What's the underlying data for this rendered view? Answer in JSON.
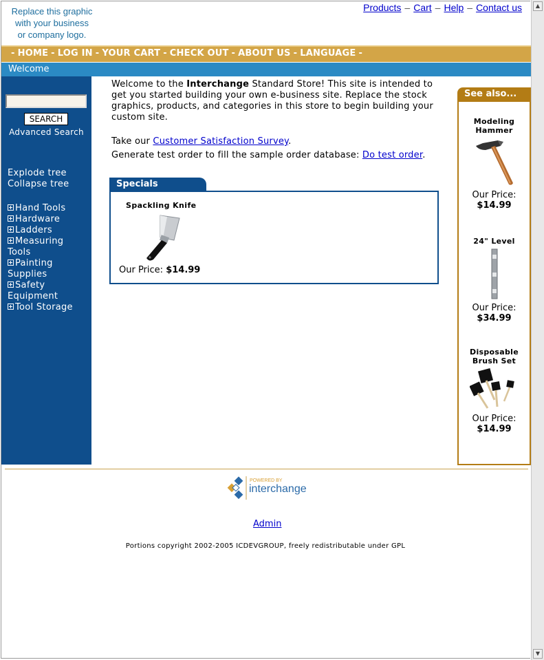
{
  "logo": {
    "line1": "Replace this graphic",
    "line2": "with your business",
    "line3": "or company logo."
  },
  "top_links": [
    "Products",
    "Cart",
    "Help",
    "Contact us"
  ],
  "navbar": [
    "HOME",
    "LOG IN",
    "YOUR CART",
    "CHECK OUT",
    "ABOUT US",
    "LANGUAGE"
  ],
  "welcome_bar": "Welcome",
  "sidebar": {
    "search_button": "SEARCH",
    "advanced_search": "Advanced Search",
    "explode_tree": "Explode tree",
    "collapse_tree": "Collapse tree",
    "categories": [
      "Hand Tools",
      "Hardware",
      "Ladders",
      "Measuring Tools",
      "Painting Supplies",
      "Safety Equipment",
      "Tool Storage"
    ]
  },
  "main": {
    "intro_pre": "Welcome to the ",
    "intro_bold": "Interchange",
    "intro_post": " Standard Store! This site is intended to get you started building your own e-business site. Replace the stock graphics, products, and categories in this store to begin building your custom site.",
    "survey_pre": "Take our ",
    "survey_link": "Customer Satisfaction Survey",
    "survey_post": ".",
    "test_pre": "Generate test order to fill the sample order database: ",
    "test_link": "Do test order",
    "test_post": "."
  },
  "specials": {
    "tab": "Specials",
    "item": {
      "name": "Spackling Knife",
      "price_label": "Our Price:",
      "price": "$14.99"
    }
  },
  "see_also": {
    "title": "See also...",
    "items": [
      {
        "name1": "Modeling",
        "name2": "Hammer",
        "price_label": "Our Price:",
        "price": "$14.99"
      },
      {
        "name1": "24\" Level",
        "name2": "",
        "price_label": "Our Price:",
        "price": "$34.99"
      },
      {
        "name1": "Disposable",
        "name2": "Brush Set",
        "price_label": "Our Price:",
        "price": "$14.99"
      }
    ]
  },
  "footer": {
    "powered_by": "POWERED BY",
    "brand": "interchange",
    "admin": "Admin",
    "copyright": "Portions copyright 2002-2005 ICDEVGROUP, freely redistributable under GPL"
  },
  "colors": {
    "nav_gold": "#d3a547",
    "welcome_blue": "#2b8ac4",
    "sidebar_navy": "#0f4e8c",
    "seealso_brown": "#b37c15"
  }
}
